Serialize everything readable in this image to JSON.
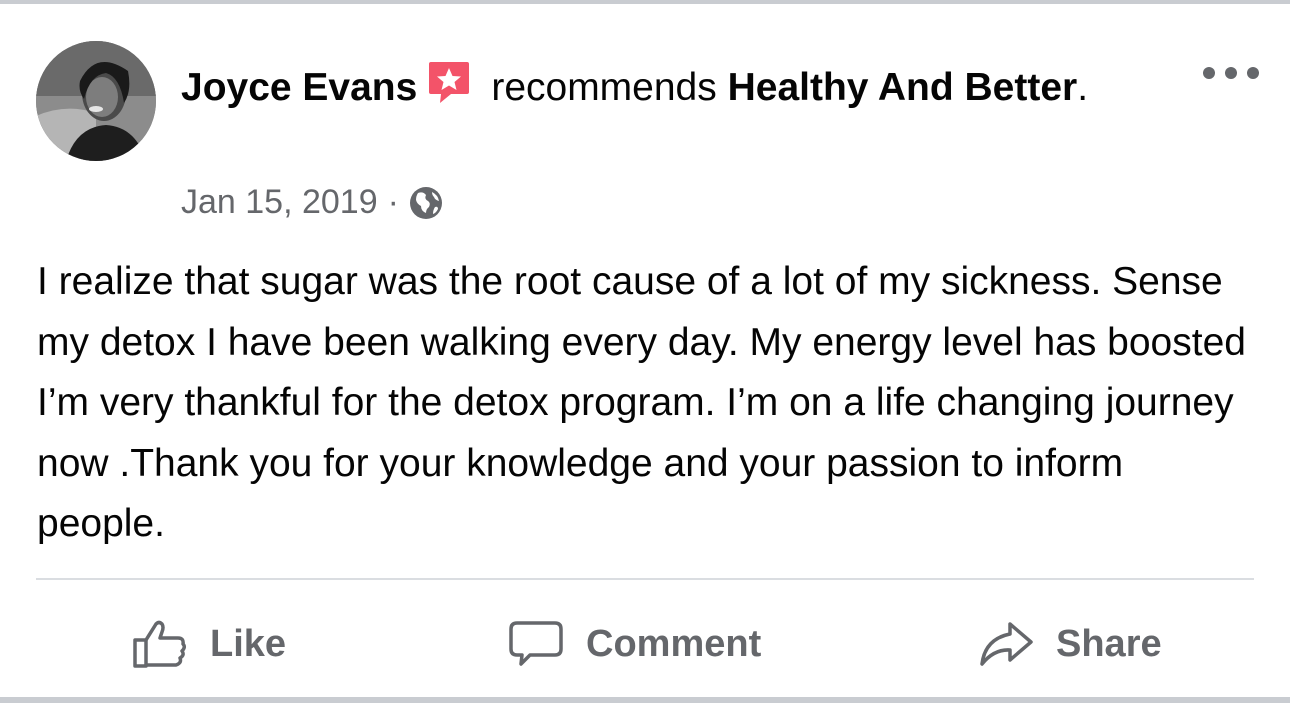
{
  "post": {
    "author": "Joyce Evans",
    "action_text": "recommends",
    "page_name": "Healthy And Better",
    "page_suffix": ".",
    "date": "Jan 15, 2019",
    "separator": "·",
    "body": "I realize that sugar was the root cause of a lot of my sickness. Sense my detox I have been walking every day. My energy level has boosted I’m very thankful for the detox program. I’m on a life changing journey now .Thank you for your knowledge and your passion to inform people."
  },
  "icons": {
    "recommend_badge": "recommend-star-icon",
    "audience": "globe-icon",
    "more": "more-options-icon",
    "like": "thumbs-up-icon",
    "comment": "comment-bubble-icon",
    "share": "share-arrow-icon"
  },
  "actions": {
    "like_label": "Like",
    "comment_label": "Comment",
    "share_label": "Share"
  },
  "colors": {
    "badge": "#f35369",
    "secondary_text": "#65676b",
    "primary_text": "#050505",
    "divider": "#dadde1"
  }
}
